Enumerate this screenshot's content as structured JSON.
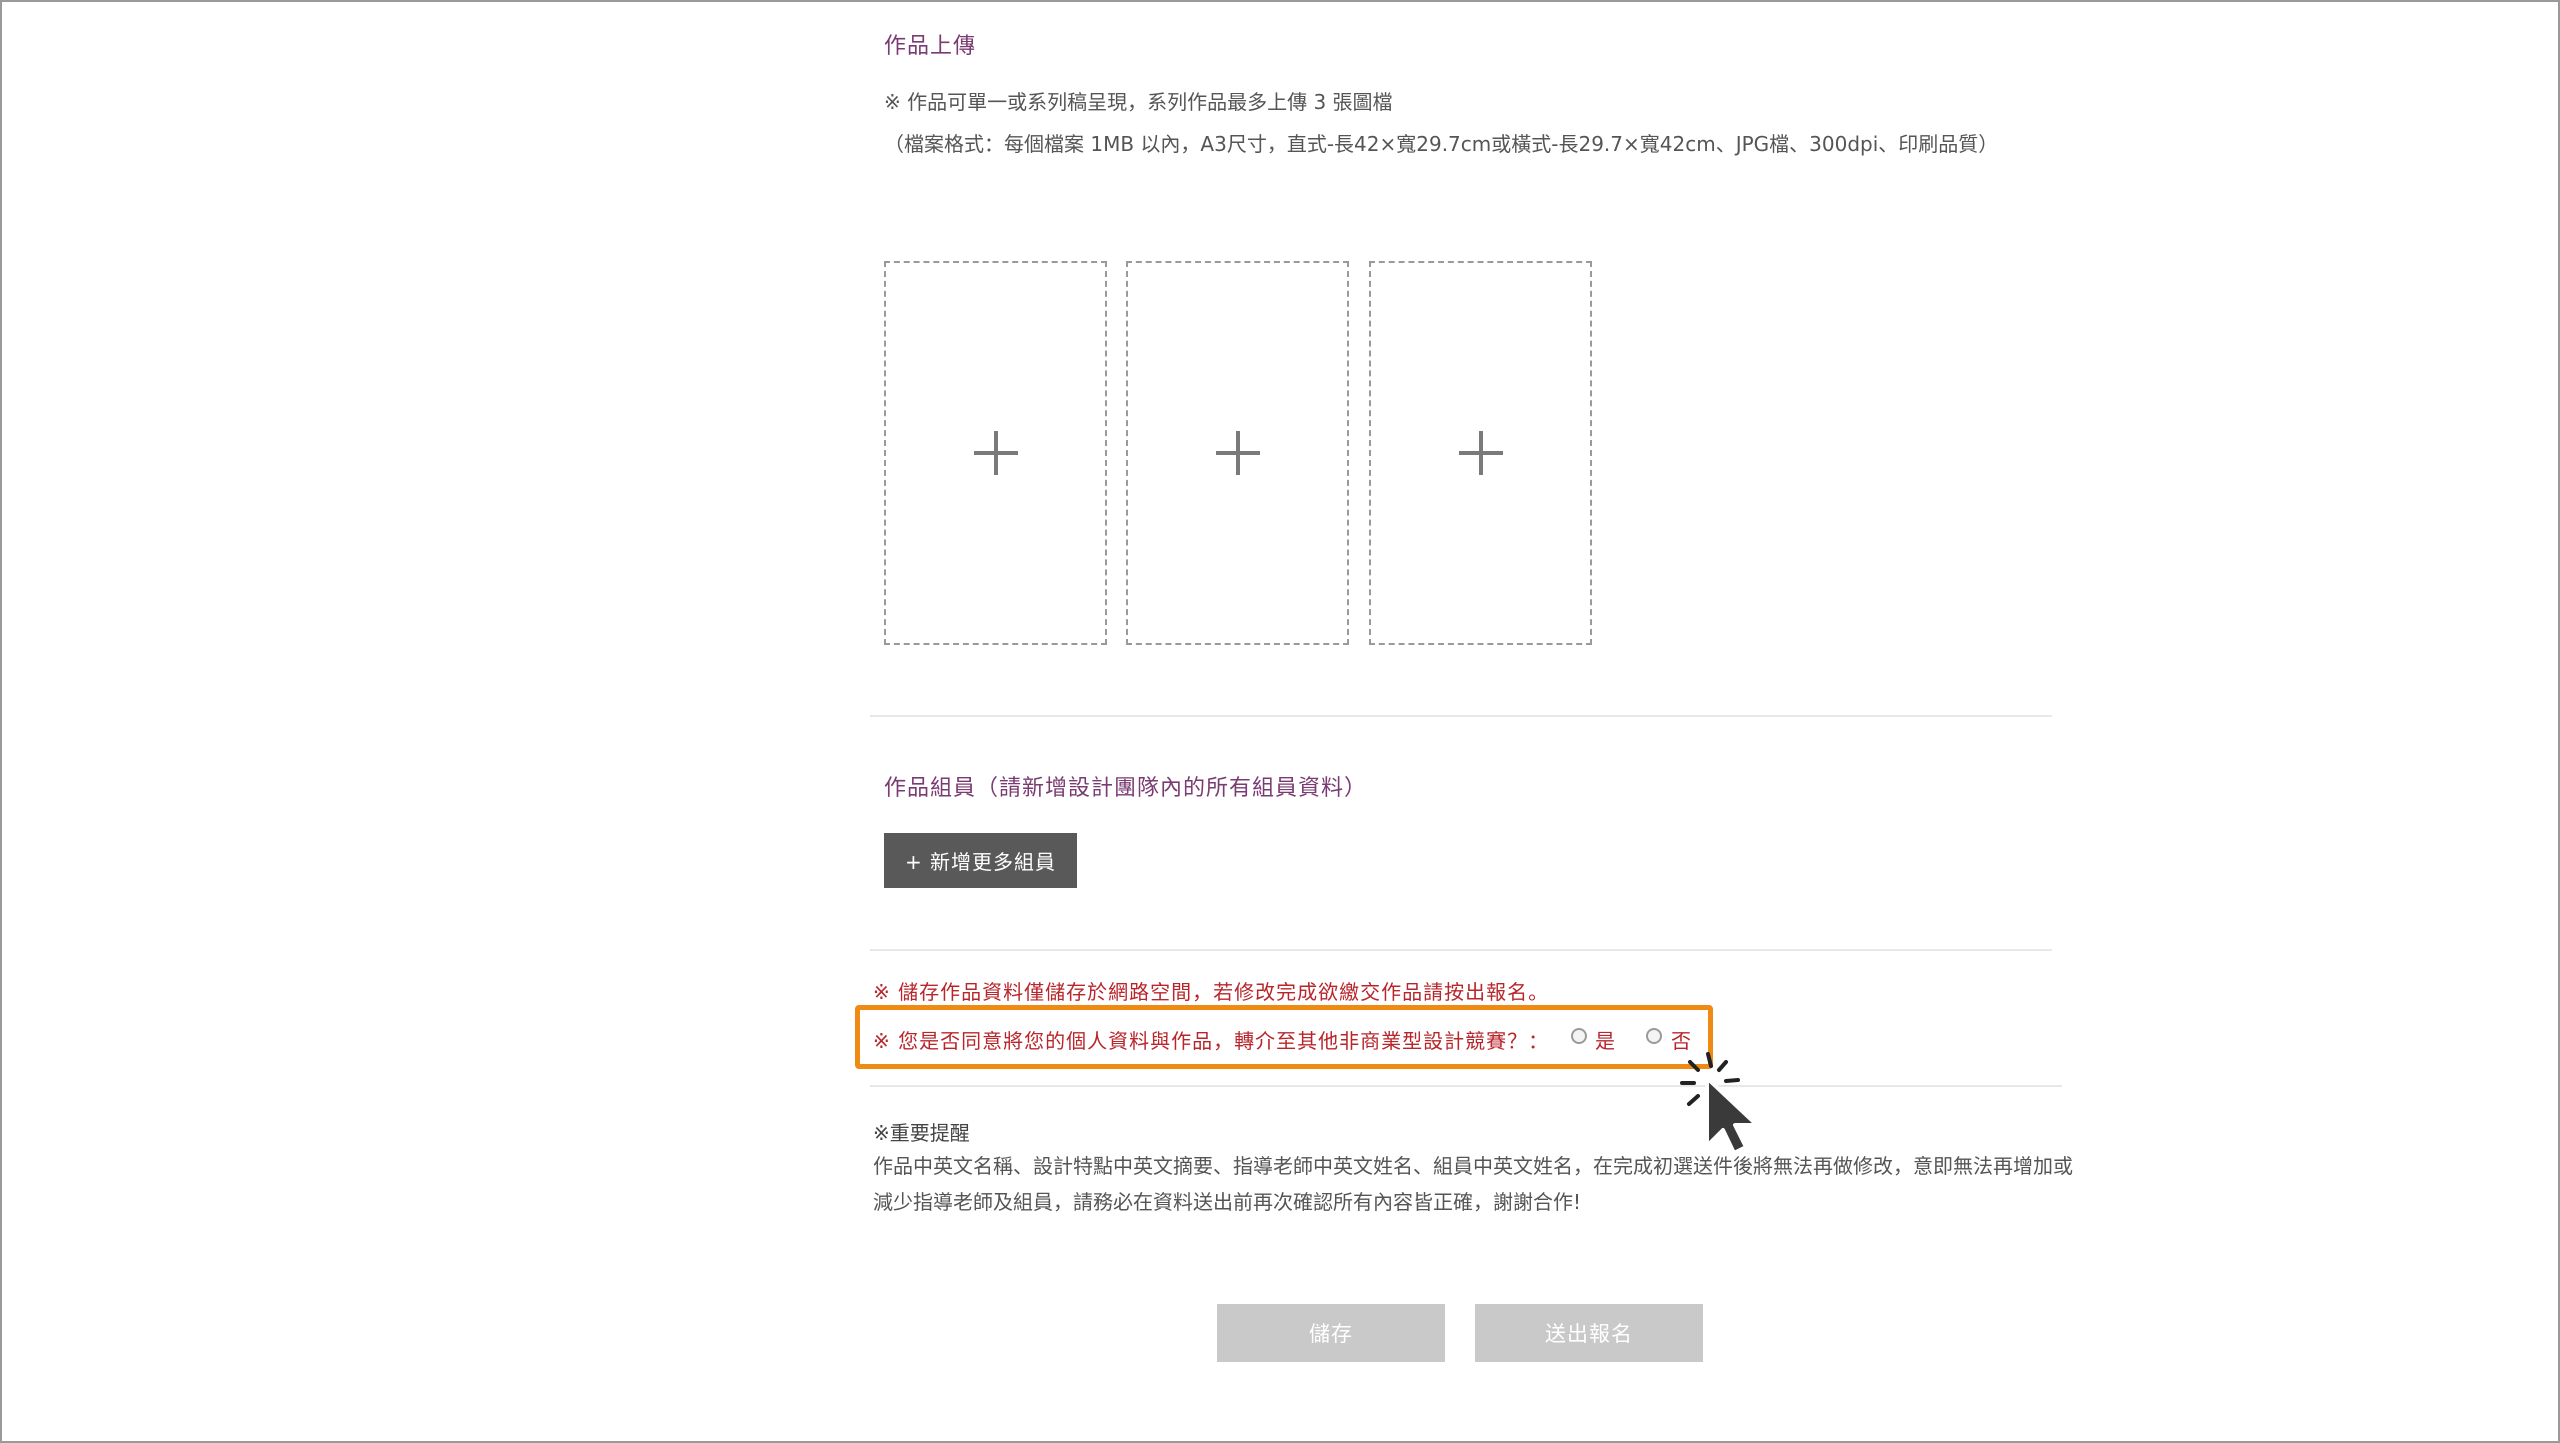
{
  "upload": {
    "title": "作品上傳",
    "note_line1": "※ 作品可單一或系列稿呈現，系列作品最多上傳 3 張圖檔",
    "note_line2": "（檔案格式：每個檔案 1MB 以內，A3尺寸，直式-長42×寬29.7cm或橫式-長29.7×寬42cm、JPG檔、300dpi、印刷品質）",
    "slots": [
      "+",
      "+",
      "+"
    ]
  },
  "members": {
    "title": "作品組員（請新增設計團隊內的所有組員資料）",
    "add_button": "+ 新增更多組員"
  },
  "consent": {
    "save_notice": "※ 儲存作品資料僅儲存於網路空間，若修改完成欲繳交作品請按出報名。",
    "question": "※ 您是否同意將您的個人資料與作品，轉介至其他非商業型設計競賽？：",
    "option_yes": "是",
    "option_no": "否"
  },
  "reminder": {
    "title": "※重要提醒",
    "text": "作品中英文名稱、設計特點中英文摘要、指導老師中英文姓名、組員中英文姓名，在完成初選送件後將無法再做修改，意即無法再增加或減少指導老師及組員，請務必在資料送出前再次確認所有內容皆正確，謝謝合作!"
  },
  "actions": {
    "save": "儲存",
    "submit": "送出報名"
  },
  "colors": {
    "title_purple": "#7a3b72",
    "warning_red": "#b8262b",
    "highlight_orange": "#ef8a12",
    "button_dark": "#595959",
    "button_disabled": "#c9c9c9"
  }
}
